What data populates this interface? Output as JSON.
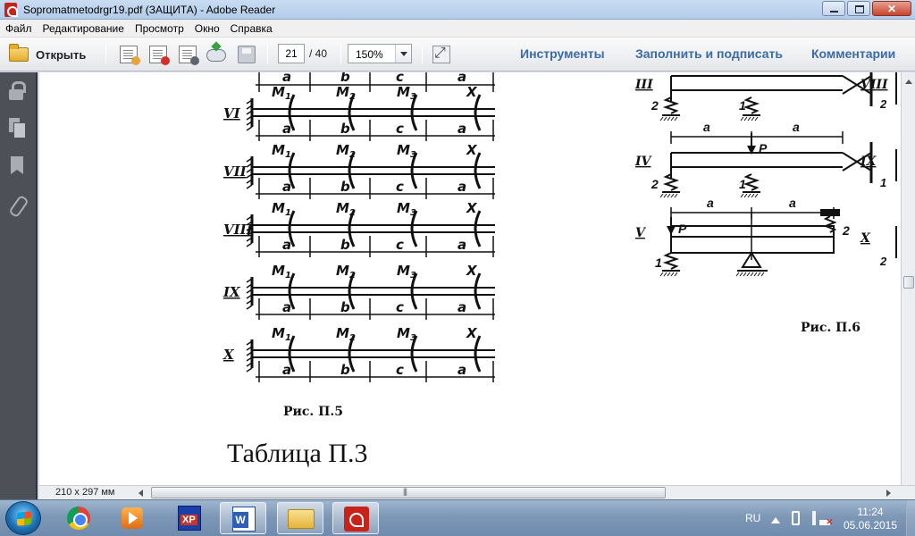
{
  "window": {
    "title": "Sopromatmetodrgr19.pdf (ЗАЩИТА) - Adobe Reader"
  },
  "menu": [
    "Файл",
    "Редактирование",
    "Просмотр",
    "Окно",
    "Справка"
  ],
  "toolbar": {
    "open_label": "Открыть",
    "page_current": "21",
    "page_total": "/ 40",
    "zoom": "150%",
    "links": [
      "Инструменты",
      "Заполнить и подписать",
      "Комментарии"
    ]
  },
  "document": {
    "left_figure": {
      "row_labels": [
        "VI",
        "VII",
        "VIII",
        "IX",
        "X"
      ],
      "moment_labels": [
        "M",
        "M",
        "M"
      ],
      "moment_subscripts": [
        "1",
        "2",
        "3"
      ],
      "span_labels": [
        "a",
        "b",
        "c",
        "a"
      ],
      "top_span_labels": [
        "a",
        "b",
        "c",
        "a"
      ],
      "end_label": "X",
      "caption": "Рис. П.5"
    },
    "right_figure": {
      "row_labels": [
        "III",
        "IV",
        "V"
      ],
      "side_row_labels": [
        "VIII",
        "IX",
        "X"
      ],
      "span_label": "a",
      "force_label": "P",
      "spring_labels": [
        "1",
        "2"
      ],
      "caption": "Рис. П.6"
    },
    "table_title": "Таблица П.3",
    "page_size": "210 x 297 мм"
  },
  "taskbar": {
    "language": "RU",
    "time": "11:24",
    "date": "05.06.2015"
  }
}
